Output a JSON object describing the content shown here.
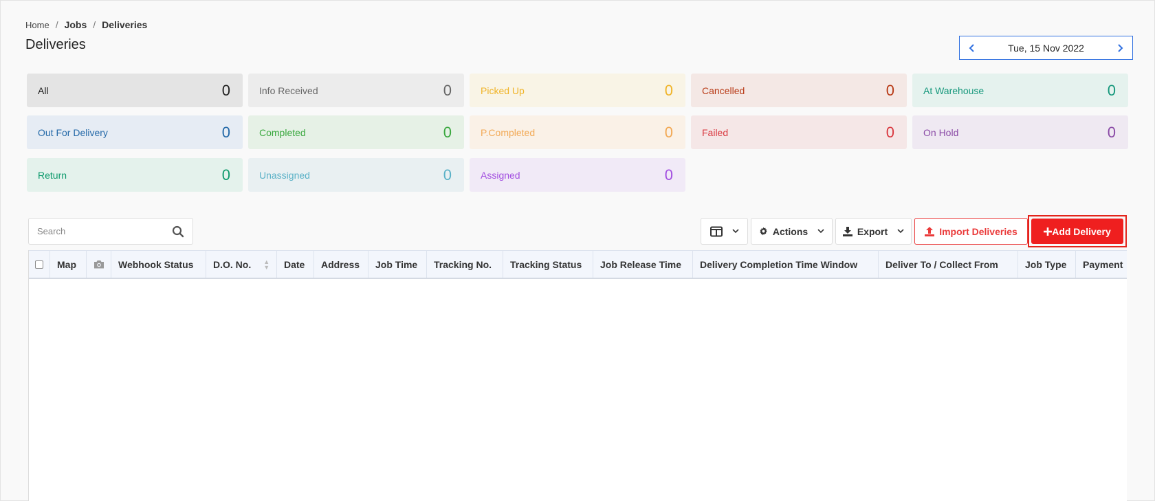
{
  "breadcrumb": {
    "home": "Home",
    "jobs": "Jobs",
    "current": "Deliveries",
    "separator": "/"
  },
  "page_title": "Deliveries",
  "date_nav": {
    "date": "Tue, 15 Nov 2022"
  },
  "status_cards": [
    {
      "label": "All",
      "count": "0",
      "bg": "#e4e4e4",
      "color": "#222222"
    },
    {
      "label": "Info Received",
      "count": "0",
      "bg": "#ececec",
      "color": "#666666"
    },
    {
      "label": "Picked Up",
      "count": "0",
      "bg": "#f9f4e6",
      "color": "#f0b429"
    },
    {
      "label": "Cancelled",
      "count": "0",
      "bg": "#f4e8e5",
      "color": "#b83a16"
    },
    {
      "label": "At Warehouse",
      "count": "0",
      "bg": "#e5f2ee",
      "color": "#16987c"
    },
    {
      "label": "Out For Delivery",
      "count": "0",
      "bg": "#e6ecf4",
      "color": "#2469a8"
    },
    {
      "label": "Completed",
      "count": "0",
      "bg": "#e6f1e6",
      "color": "#3aa83f"
    },
    {
      "label": "P.Completed",
      "count": "0",
      "bg": "#faf1e7",
      "color": "#f2a955"
    },
    {
      "label": "Failed",
      "count": "0",
      "bg": "#f5e7e7",
      "color": "#d9383f"
    },
    {
      "label": "On Hold",
      "count": "0",
      "bg": "#efe9f2",
      "color": "#8a4aa6"
    },
    {
      "label": "Return",
      "count": "0",
      "bg": "#e4f2ec",
      "color": "#0d9a6c"
    },
    {
      "label": "Unassigned",
      "count": "0",
      "bg": "#e9f0f2",
      "color": "#5ab1c7"
    },
    {
      "label": "Assigned",
      "count": "0",
      "bg": "#f1eaf7",
      "color": "#a24ee0"
    }
  ],
  "search": {
    "placeholder": "Search"
  },
  "toolbar": {
    "actions_label": "Actions",
    "export_label": "Export",
    "import_label": "Import Deliveries",
    "add_label": "Add Delivery"
  },
  "table": {
    "columns": [
      "Map",
      "Webhook Status",
      "D.O. No.",
      "Date",
      "Address",
      "Job Time",
      "Tracking No.",
      "Tracking Status",
      "Job Release Time",
      "Delivery Completion Time Window",
      "Deliver To / Collect From",
      "Job Type",
      "Payment"
    ]
  },
  "colors": {
    "accent": "#2f6fe0",
    "danger": "#ef1f1f"
  }
}
